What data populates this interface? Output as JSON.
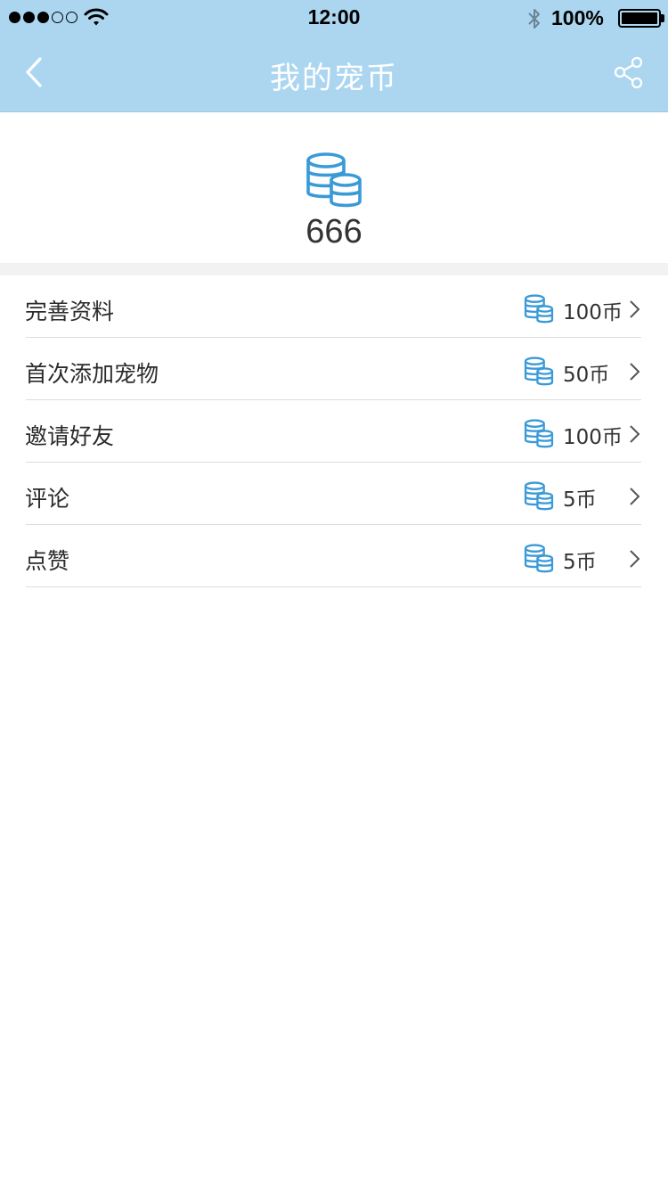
{
  "status_bar": {
    "time": "12:00",
    "battery": "100%",
    "signal_icon": "cellular-signal-icon",
    "wifi_icon": "wifi-icon",
    "bluetooth_icon": "bluetooth-icon",
    "battery_icon": "battery-icon",
    "battery_level": 1.0
  },
  "nav": {
    "title": "我的宠币",
    "back_icon": "chevron-left-icon",
    "share_icon": "share-icon"
  },
  "balance": {
    "icon": "coin-stack-icon",
    "value": "666"
  },
  "tasks": [
    {
      "label": "完善资料",
      "reward": "100币",
      "icon": "coin-stack-icon"
    },
    {
      "label": "首次添加宠物",
      "reward": "50币",
      "icon": "coin-stack-icon"
    },
    {
      "label": "邀请好友",
      "reward": "100币",
      "icon": "coin-stack-icon"
    },
    {
      "label": "评论",
      "reward": "5币",
      "icon": "coin-stack-icon"
    },
    {
      "label": "点赞",
      "reward": "5币",
      "icon": "coin-stack-icon"
    }
  ],
  "colors": {
    "header_bg": "#acd6f0",
    "coin_blue": "#3a9ad8",
    "divider": "#dcdcdc",
    "section_gap": "#f2f2f2"
  }
}
